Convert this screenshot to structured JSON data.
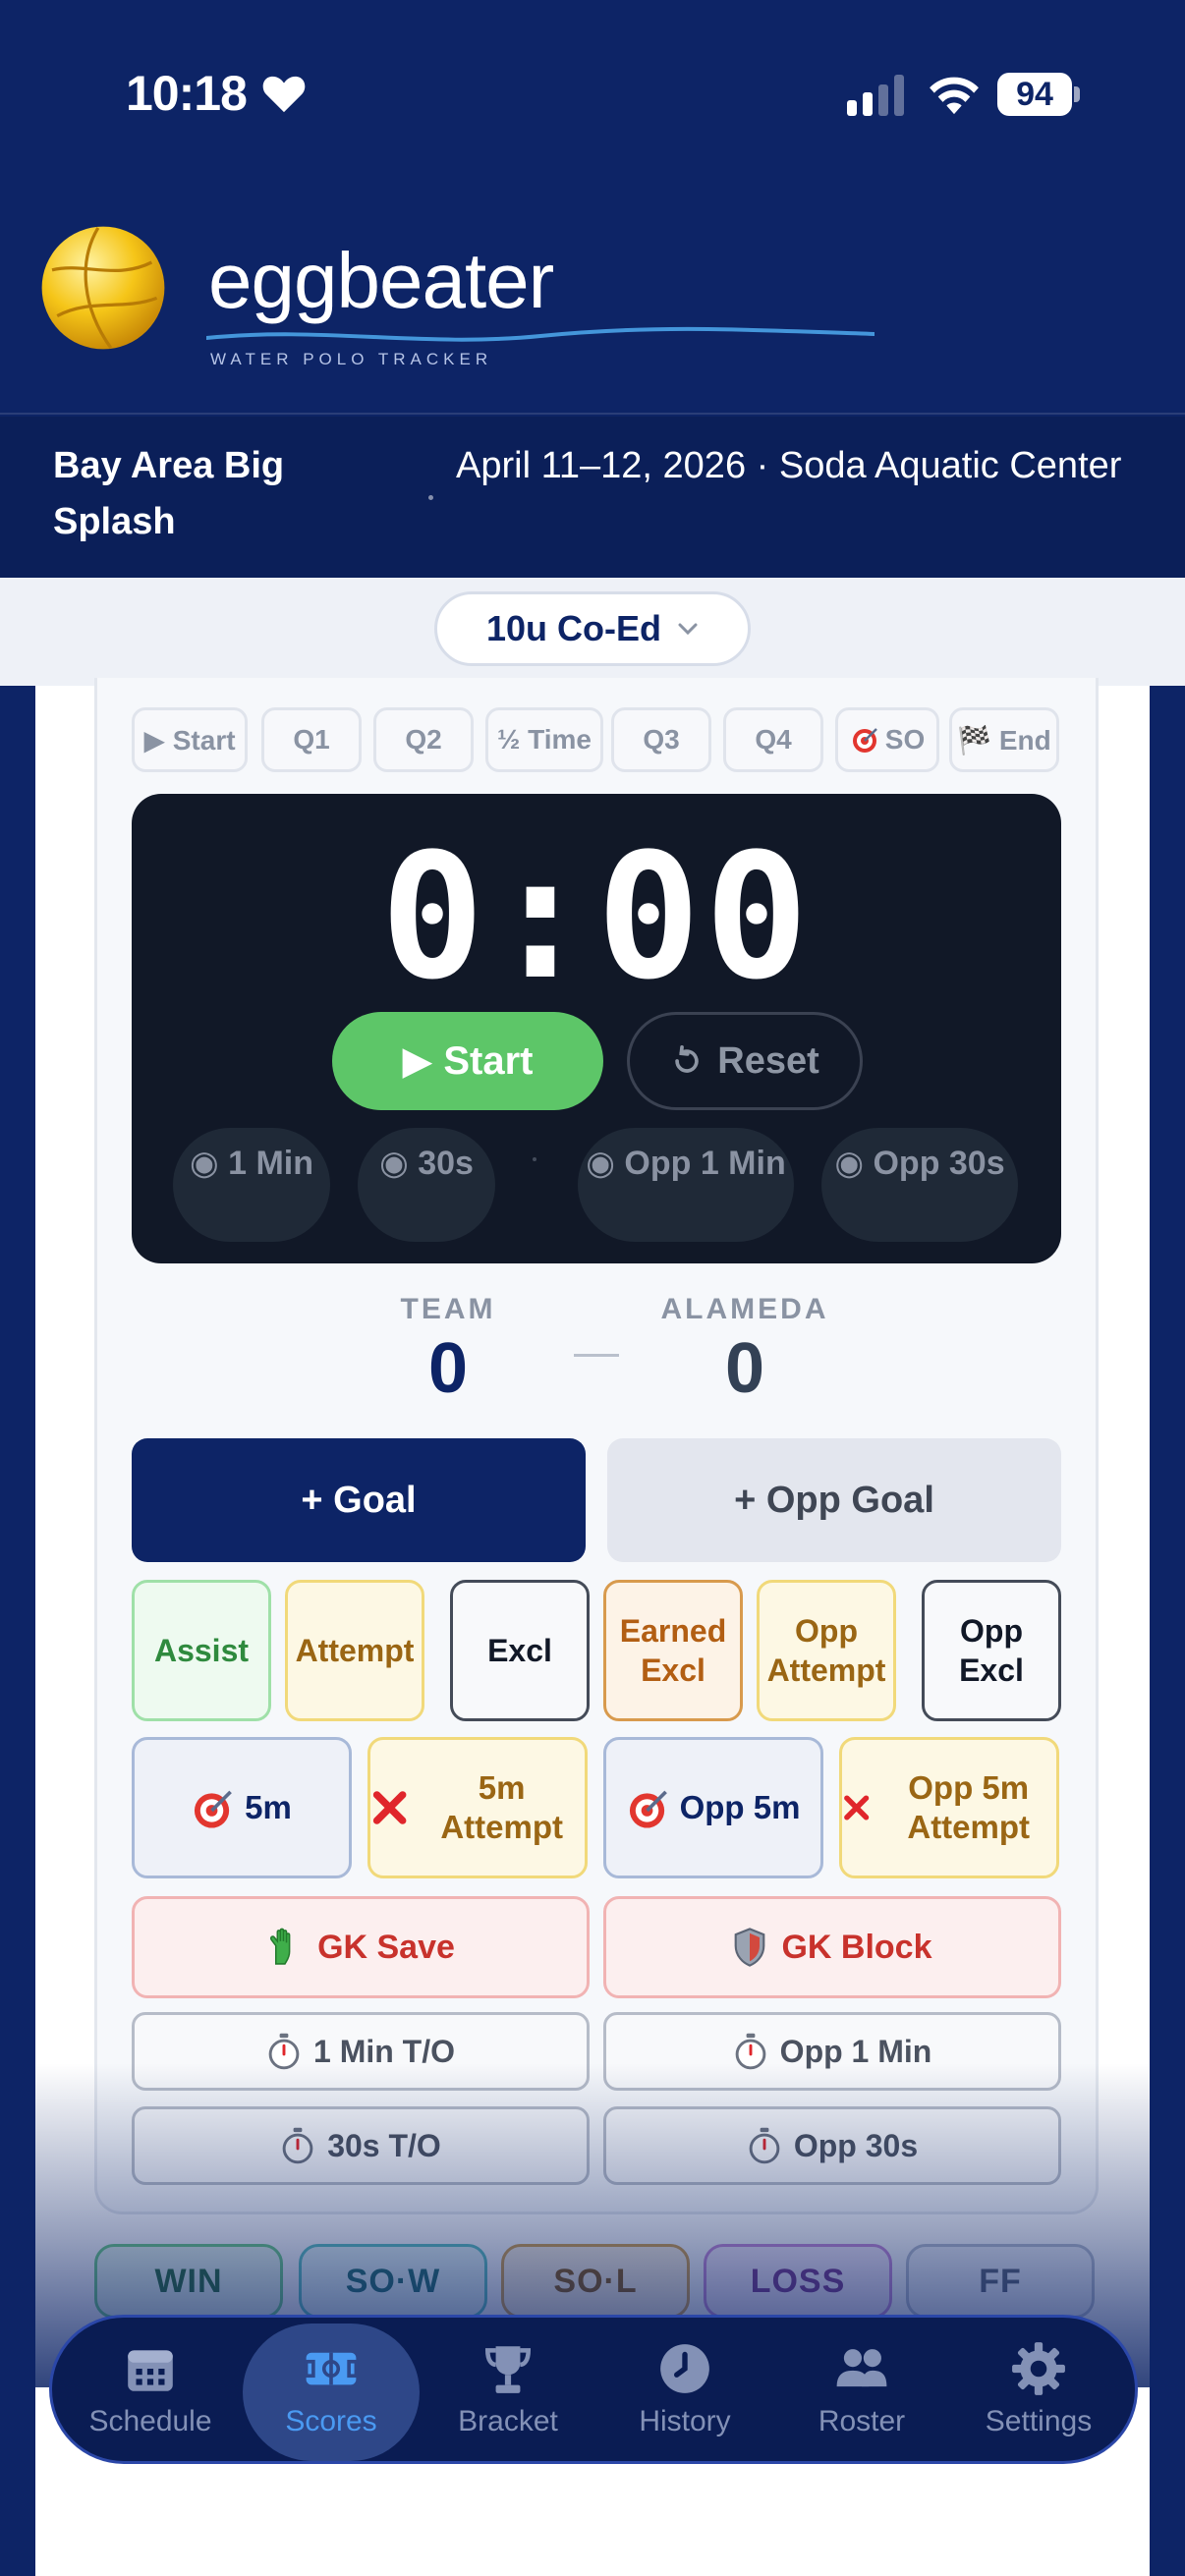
{
  "status_bar": {
    "time": "10:18",
    "battery": "94"
  },
  "brand": {
    "name": "eggbeater",
    "tagline": "WATER POLO TRACKER"
  },
  "event": {
    "name": "Bay Area Big Splash",
    "meta": "April 11–12, 2026 · Soda Aquatic Center"
  },
  "division": {
    "selected": "10u Co-Ed"
  },
  "periods": [
    {
      "label": "▶ Start"
    },
    {
      "label": "Q1"
    },
    {
      "label": "Q2"
    },
    {
      "label": "½ Time"
    },
    {
      "label": "Q3"
    },
    {
      "label": "Q4"
    },
    {
      "label": "SO"
    },
    {
      "label": "🏁 End"
    }
  ],
  "timer": {
    "display": "0:00",
    "start_label": "▶ Start",
    "reset_label": "Reset",
    "presets": [
      "◉ 1 Min",
      "◉ 30s",
      "◉ Opp 1 Min",
      "◉ Opp 30s"
    ]
  },
  "score": {
    "team_label": "TEAM",
    "team_score": "0",
    "opp_label": "ALAMEDA",
    "opp_score": "0"
  },
  "actions": {
    "goal": "+ Goal",
    "opp_goal": "+ Opp Goal",
    "assist": "Assist",
    "attempt": "Attempt",
    "excl": "Excl",
    "earned_excl": "Earned Excl",
    "opp_attempt": "Opp Attempt",
    "opp_excl": "Opp Excl",
    "five_m": "5m",
    "five_m_attempt": "5m Attempt",
    "opp_five_m": "Opp 5m",
    "opp_five_m_attempt": "Opp 5m Attempt",
    "gk_save": "GK Save",
    "gk_block": "GK Block",
    "one_min_to": "1 Min T/O",
    "opp_one_min": "Opp 1 Min",
    "thirty_to": "30s T/O",
    "opp_thirty": "Opp 30s"
  },
  "results": [
    "WIN",
    "SO·W",
    "SO·L",
    "LOSS",
    "FF"
  ],
  "tabs": [
    {
      "label": "Schedule"
    },
    {
      "label": "Scores"
    },
    {
      "label": "Bracket"
    },
    {
      "label": "History"
    },
    {
      "label": "Roster"
    },
    {
      "label": "Settings"
    }
  ],
  "colors": {
    "navy": "#0d2466",
    "accent": "#3b82f6",
    "start_green": "#5dc668",
    "danger": "#c8322c"
  }
}
